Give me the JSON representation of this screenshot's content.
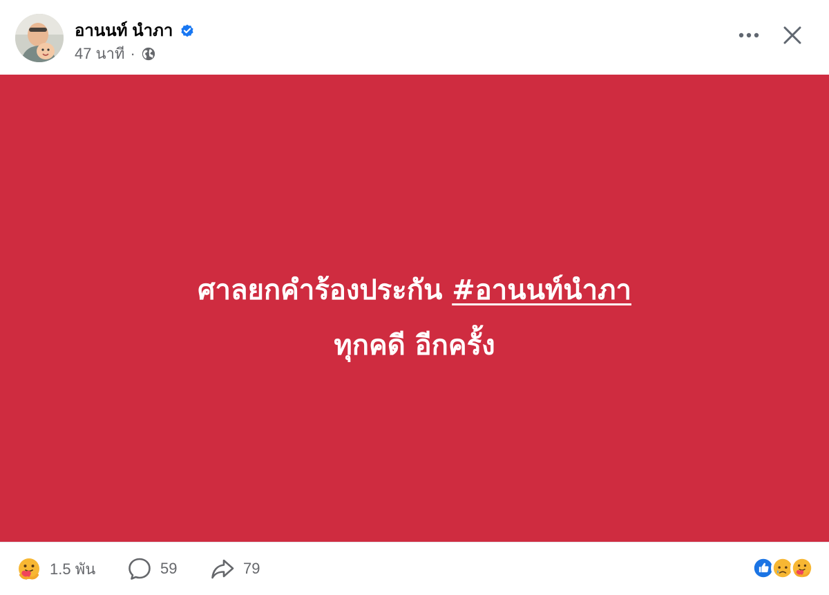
{
  "author": {
    "name": "อานนท์ นำภา",
    "verified": true,
    "time": "47 นาที",
    "separator": "·",
    "audience_icon": "globe-icon"
  },
  "header_actions": {
    "more_icon": "more-horizontal-icon",
    "close_icon": "close-icon"
  },
  "image": {
    "background_color": "#cf2c40",
    "line1_text": "ศาลยกคำร้องประกัน ",
    "line1_hashtag": "#อานนท์นำภา",
    "line2_text": "ทุกคดี อีกครั้ง"
  },
  "footer": {
    "reactions_count": "1.5 พัน",
    "comments_count": "59",
    "shares_count": "79",
    "reaction_icons": [
      "like-icon",
      "sad-icon",
      "care-icon"
    ]
  }
}
